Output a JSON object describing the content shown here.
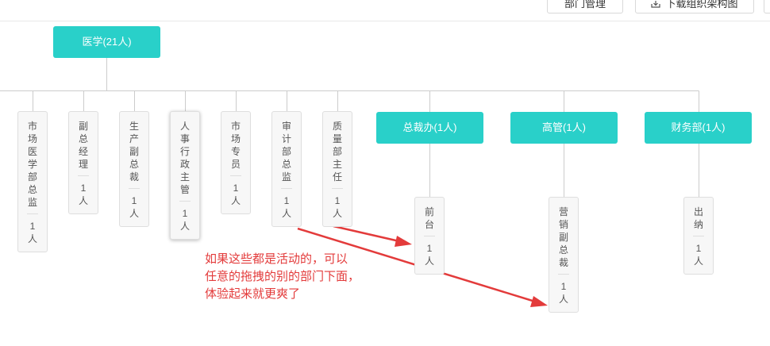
{
  "toolbar": {
    "dept_manage_label": "部门管理",
    "download_label": "下载组织架构图",
    "download_icon": "download-icon"
  },
  "colors": {
    "dept": "#29d0c9",
    "annotation": "#e33b3b"
  },
  "root": {
    "label": "医学(21人)"
  },
  "positions": [
    {
      "title": "市场医学部总监",
      "count": "1人"
    },
    {
      "title": "副总经理",
      "count": "1人"
    },
    {
      "title": "生产副总裁",
      "count": "1人"
    },
    {
      "title": "人事行政主管",
      "count": "1人"
    },
    {
      "title": "市场专员",
      "count": "1人"
    },
    {
      "title": "审计部总监",
      "count": "1人"
    },
    {
      "title": "质量部主任",
      "count": "1人"
    }
  ],
  "departments": [
    {
      "label": "总裁办(1人)",
      "child": {
        "title": "前台",
        "count": "1人"
      }
    },
    {
      "label": "高管(1人)",
      "child": {
        "title": "营销副总裁",
        "count": "1人"
      }
    },
    {
      "label": "财务部(1人)",
      "child": {
        "title": "出纳",
        "count": "1人"
      }
    }
  ],
  "annotation": {
    "lines": [
      "如果这些都是活动的，可以",
      "任意的拖拽的别的部门下面，",
      "体验起来就更爽了"
    ]
  }
}
